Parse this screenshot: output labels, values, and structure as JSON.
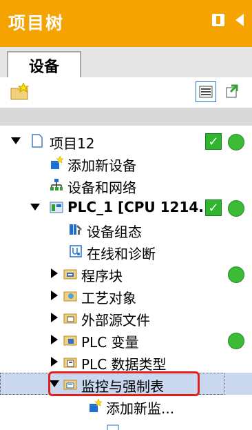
{
  "panel": {
    "title": "项目树"
  },
  "tabs": [
    {
      "label": "设备"
    }
  ],
  "colors": {
    "accent": "#f5a300",
    "highlight": "#c9d8ef",
    "status_green": "#3dbb37",
    "callout_red": "#e0201b"
  },
  "tree": {
    "items": [
      {
        "label": "项目12",
        "expander": "down",
        "icon": "project-icon",
        "check": true,
        "dot": true
      },
      {
        "label": "添加新设备",
        "expander": "none",
        "icon": "add-device-icon",
        "check": false,
        "dot": false
      },
      {
        "label": "设备和网络",
        "expander": "none",
        "icon": "network-icon",
        "check": false,
        "dot": false
      },
      {
        "label": "PLC_1 [CPU 1214...",
        "expander": "down",
        "icon": "plc-icon",
        "check": true,
        "dot": true
      },
      {
        "label": "设备组态",
        "expander": "none",
        "icon": "device-config-icon",
        "check": false,
        "dot": false
      },
      {
        "label": "在线和诊断",
        "expander": "none",
        "icon": "online-diagnostics-icon",
        "check": false,
        "dot": false
      },
      {
        "label": "程序块",
        "expander": "right",
        "icon": "program-blocks-icon",
        "check": false,
        "dot": true
      },
      {
        "label": "工艺对象",
        "expander": "right",
        "icon": "technology-objects-icon",
        "check": false,
        "dot": false
      },
      {
        "label": "外部源文件",
        "expander": "right",
        "icon": "external-source-icon",
        "check": false,
        "dot": false
      },
      {
        "label": "PLC 变量",
        "expander": "right",
        "icon": "plc-tags-icon",
        "check": false,
        "dot": true
      },
      {
        "label": "PLC 数据类型",
        "expander": "right",
        "icon": "plc-data-types-icon",
        "check": false,
        "dot": false
      },
      {
        "label": "监控与强制表",
        "expander": "down",
        "icon": "watch-force-tables-icon",
        "check": false,
        "dot": false,
        "selected": true
      },
      {
        "label": "添加新监...",
        "expander": "none",
        "icon": "add-watch-table-icon",
        "check": false,
        "dot": false
      }
    ]
  }
}
